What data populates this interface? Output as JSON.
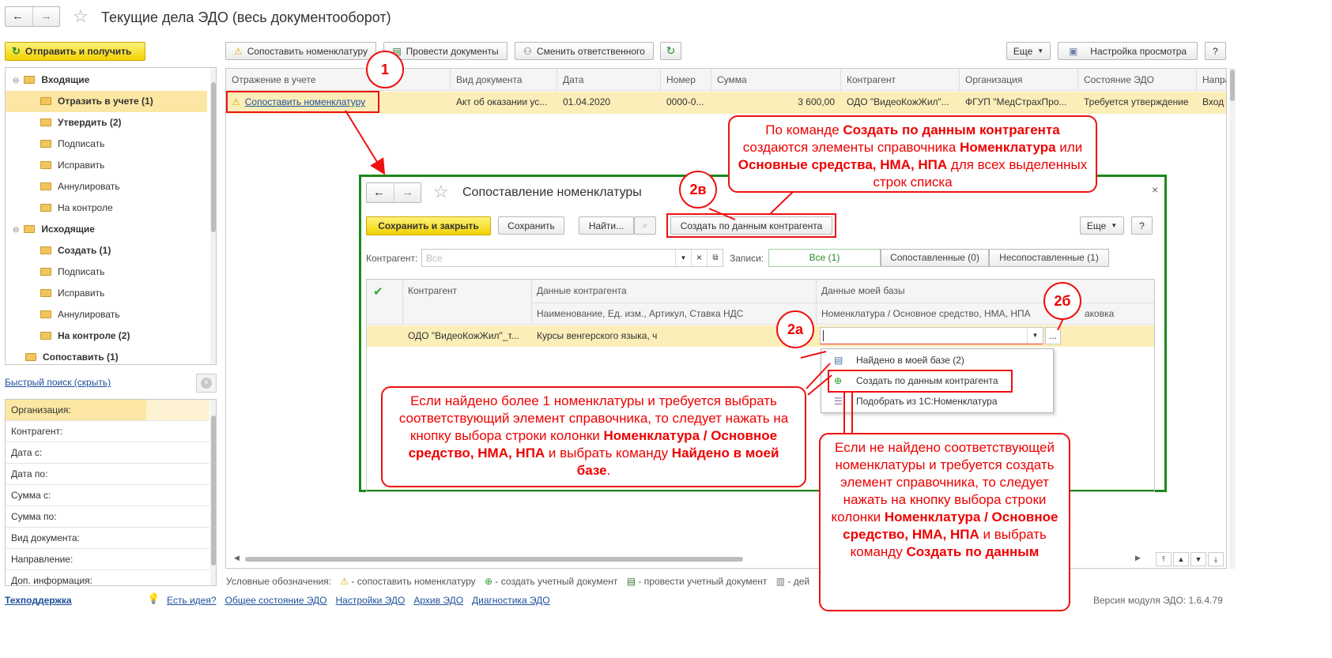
{
  "window": {
    "title": "Текущие дела ЭДО (весь документооборот)",
    "star": "☆"
  },
  "left": {
    "send_btn": "Отправить и получить",
    "tree": [
      {
        "label": "Входящие",
        "bold": true,
        "level": 0
      },
      {
        "label": "Отразить в учете (1)",
        "bold": true,
        "level": 1,
        "selected": true
      },
      {
        "label": "Утвердить (2)",
        "bold": true,
        "level": 1
      },
      {
        "label": "Подписать",
        "bold": false,
        "level": 1
      },
      {
        "label": "Исправить",
        "bold": false,
        "level": 1
      },
      {
        "label": "Аннулировать",
        "bold": false,
        "level": 1
      },
      {
        "label": "На контроле",
        "bold": false,
        "level": 1
      },
      {
        "label": "Исходящие",
        "bold": true,
        "level": 0
      },
      {
        "label": "Создать (1)",
        "bold": true,
        "level": 1
      },
      {
        "label": "Подписать",
        "bold": false,
        "level": 1
      },
      {
        "label": "Исправить",
        "bold": false,
        "level": 1
      },
      {
        "label": "Аннулировать",
        "bold": false,
        "level": 1
      },
      {
        "label": "На контроле (2)",
        "bold": true,
        "level": 1
      },
      {
        "label": "Сопоставить (1)",
        "bold": true,
        "level": 0
      }
    ],
    "quick_search": "Быстрый поиск (скрыть)",
    "filters": [
      "Организация:",
      "Контрагент:",
      "Дата с:",
      "Дата по:",
      "Сумма с:",
      "Сумма по:",
      "Вид документа:",
      "Направление:",
      "Доп. информация:"
    ]
  },
  "toolbar": {
    "match": "Сопоставить номенклатуру",
    "post": "Провести документы",
    "change": "Сменить ответственного",
    "more": "Еще",
    "view": "Настройка просмотра",
    "help": "?"
  },
  "grid": {
    "headers": [
      "Отражение в учете",
      "Вид документа",
      "Дата",
      "Номер",
      "Сумма",
      "Контрагент",
      "Организация",
      "Состояние ЭДО",
      "Напра"
    ],
    "row": [
      "Сопоставить номенклатуру",
      "Акт об оказании ус...",
      "01.04.2020",
      "0000-0...",
      "3 600,00",
      "ОДО \"ВидеоКожЖил\"...",
      "ФГУП \"МедСтрахПро...",
      "Требуется утверждение",
      "Вход"
    ]
  },
  "dialog": {
    "title": "Сопоставление номенклатуры",
    "save_close": "Сохранить и закрыть",
    "save": "Сохранить",
    "find": "Найти...",
    "create": "Создать по данным контрагента",
    "more": "Еще",
    "help": "?",
    "contractor_label": "Контрагент:",
    "contractor_placeholder": "Все",
    "records_label": "Записи:",
    "tabs": [
      "Все (1)",
      "Сопоставленные (0)",
      "Несопоставленные (1)"
    ],
    "col_contractor": "Контрагент",
    "col_data": "Данные контрагента",
    "col_data_sub": "Наименование, Ед. изм., Артикул, Ставка НДС",
    "col_mybase": "Данные моей базы",
    "col_mybase_sub": "Номенклатура / Основное средство, НМА, НПА",
    "col_pack": "аковка",
    "row_contractor": "ОДО \"ВидеоКожЖил\"_т...",
    "row_data": "Курсы венгерского языка, ч",
    "menu": [
      "Найдено в моей базе (2)",
      "Создать по данным контрагента",
      "Подобрать из 1С:Номенклатура"
    ]
  },
  "legend": {
    "label": "Условные обозначения:",
    "items": [
      "- сопоставить номенклатуру",
      "- создать учетный документ",
      "- провести учетный документ",
      "- дей"
    ]
  },
  "footer": {
    "support": "Техподдержка",
    "links": [
      "Есть идея?",
      "Общее состояние ЭДО",
      "Настройки ЭДО",
      "Архив ЭДО",
      "Диагностика ЭДО"
    ],
    "version": "Версия модуля ЭДО: 1.6.4.79"
  },
  "callouts": {
    "c1": "1",
    "c2a": "2а",
    "c2b": "2б",
    "c2v": "2в",
    "top_pre": "По команде ",
    "top_b1": "Создать по данным контрагента",
    "top_mid": " создаются элементы справочника ",
    "top_b2": "Номенклатура",
    "top_or": " или ",
    "top_b3": "Основные средства, НМА, НПА",
    "top_post": " для всех выделенных строк списка",
    "left_pre": "Если найдено более 1 номенклатуры и требуется выбрать соответствующий элемент справочника, то следует нажать на кнопку выбора строки колонки ",
    "left_b1": "Номенклатура / Основное средство, НМА, НПА",
    "left_mid": " и выбрать команду ",
    "left_b2": "Найдено в моей базе",
    "left_post": ".",
    "right_pre": "Если не найдено соответствующей номенклатуры и требуется создать элемент справочника, то следует нажать на кнопку выбора строки колонки ",
    "right_b1": "Номенклатура / Основное средство, НМА, НПА",
    "right_mid": " и выбрать команду ",
    "right_b2": "Создать по данным"
  }
}
